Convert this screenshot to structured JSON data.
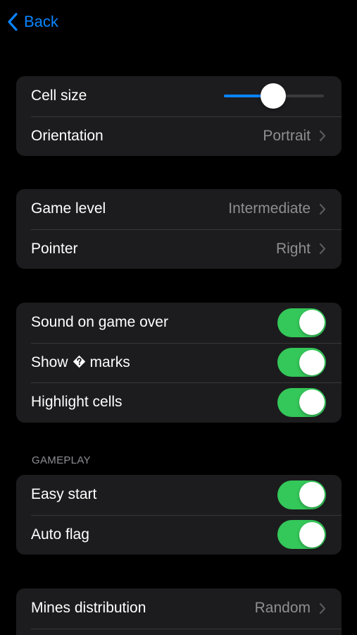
{
  "nav": {
    "back_label": "Back"
  },
  "colors": {
    "accent": "#0a84ff",
    "toggle_on": "#34c759",
    "group_bg": "#1c1c1e",
    "secondary_text": "#8e8e93"
  },
  "display": {
    "cell_size_label": "Cell size",
    "cell_size_value": 0.49,
    "orientation_label": "Orientation",
    "orientation_value": "Portrait"
  },
  "game": {
    "level_label": "Game level",
    "level_value": "Intermediate",
    "pointer_label": "Pointer",
    "pointer_value": "Right"
  },
  "toggles": {
    "sound_label": "Sound on game over",
    "sound_on": true,
    "show_marks_prefix": "Show",
    "show_marks_icon": "question-diamond-icon",
    "show_marks_suffix": "marks",
    "show_marks_on": true,
    "highlight_label": "Highlight cells",
    "highlight_on": true
  },
  "gameplay": {
    "header": "GAMEPLAY",
    "easy_start_label": "Easy start",
    "easy_start_on": true,
    "auto_flag_label": "Auto flag",
    "auto_flag_on": true
  },
  "mines": {
    "distribution_label": "Mines distribution",
    "distribution_value": "Random"
  }
}
